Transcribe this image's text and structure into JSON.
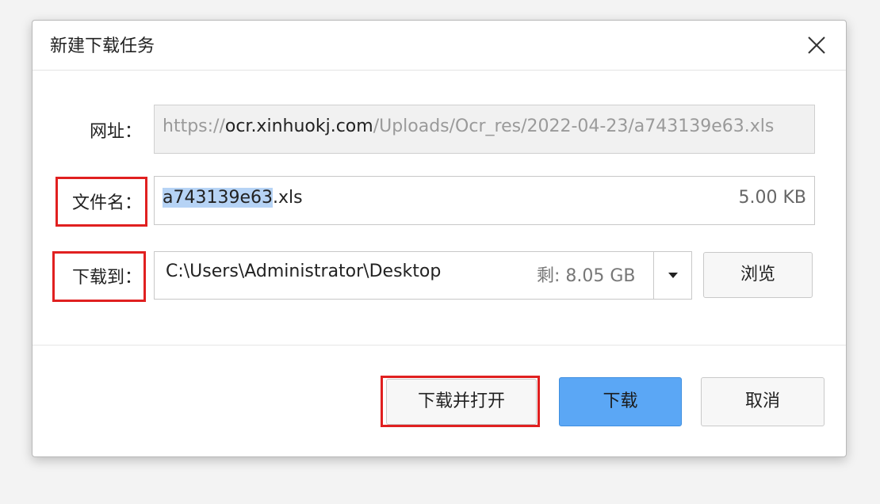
{
  "dialog": {
    "title": "新建下载任务",
    "close_icon": "close-icon"
  },
  "url_row": {
    "label": "网址：",
    "prefix": "https://",
    "host": "ocr.xinhuokj.com",
    "path": "/Uploads/Ocr_res/2022-04-23/a743139e63.xls"
  },
  "filename_row": {
    "label": "文件名：",
    "selected": "a743139e63",
    "extension": ".xls",
    "size": "5.00 KB"
  },
  "saveto_row": {
    "label": "下载到：",
    "path": "C:\\Users\\Administrator\\Desktop",
    "free_space": "剩: 8.05 GB",
    "dropdown_icon": "caret-down-icon",
    "browse_label": "浏览"
  },
  "actions": {
    "download_open_label": "下载并打开",
    "download_label": "下载",
    "cancel_label": "取消"
  },
  "colors": {
    "highlight": "#e02020",
    "primary": "#5ba7f5",
    "selection": "#b6d3f5"
  }
}
